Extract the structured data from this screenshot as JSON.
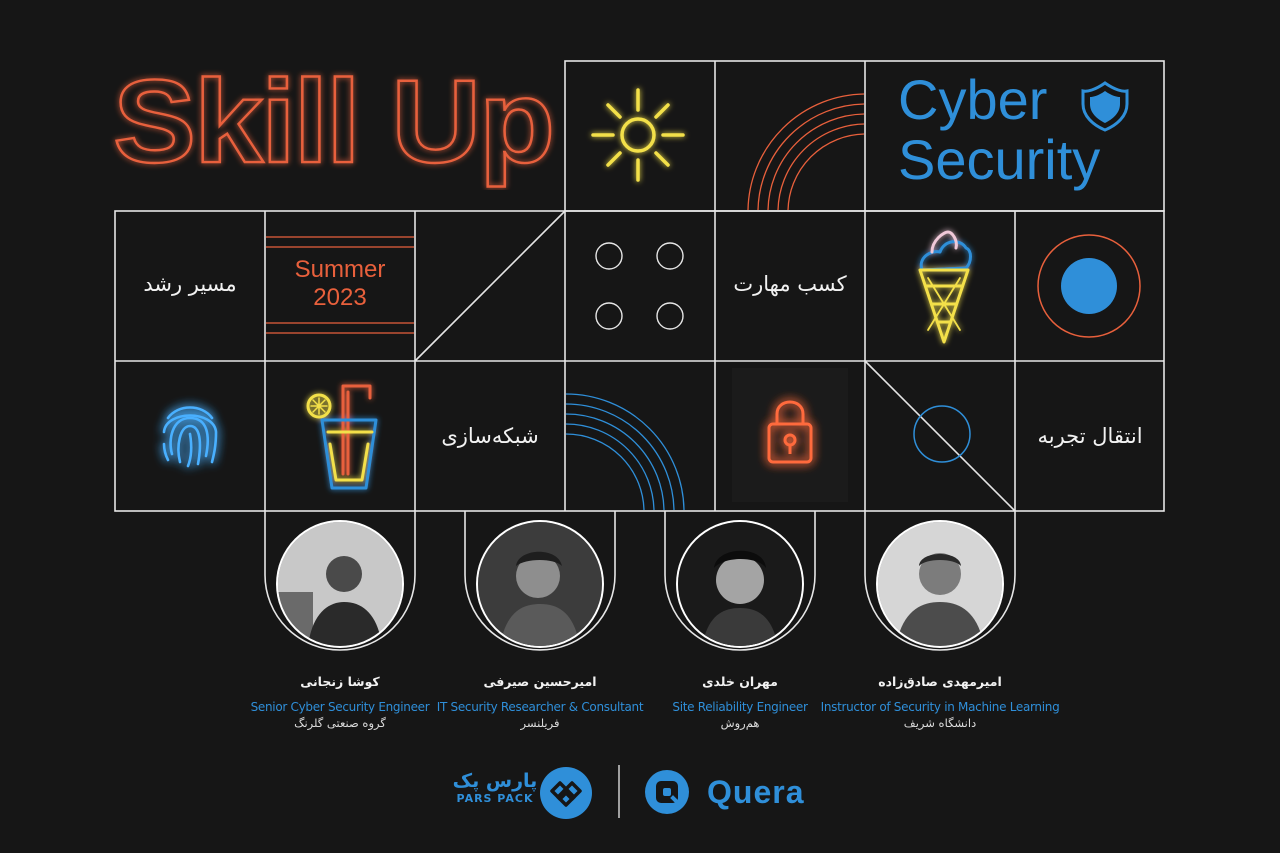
{
  "title": "Skill Up",
  "cyber": {
    "line1": "Cyber",
    "line2": "Security"
  },
  "summer": {
    "line1": "Summer",
    "line2": "2023"
  },
  "tiles": {
    "growth_path": "مسیر رشد",
    "skill_gain": "کسب مهارت",
    "networking": "شبکه‌سازی",
    "experience_transfer": "انتقال تجربه"
  },
  "speakers": [
    {
      "name": "کوشا زنجانی",
      "role": "Senior Cyber Security Engineer",
      "org": "گروه صنعتی گلرنگ"
    },
    {
      "name": "امیرحسین صیرفی",
      "role": "IT Security Researcher & Consultant",
      "org": "فریلنسر"
    },
    {
      "name": "مهران خلدی",
      "role": "Site Reliability Engineer",
      "org": "هم‌روش"
    },
    {
      "name": "امیرمهدی صادق‌زاده",
      "role": "Instructor of Security in Machine Learning",
      "org": "دانشگاه شریف"
    }
  ],
  "sponsors": {
    "parspack_fa": "پارس پک",
    "parspack_en": "PARS PACK",
    "quera": "Quera"
  },
  "colors": {
    "background": "#161616",
    "grid_line": "#e6e6e6",
    "neon_orange": "#e8603c",
    "neon_yellow": "#f3e04a",
    "neon_blue": "#2f8fd9"
  }
}
